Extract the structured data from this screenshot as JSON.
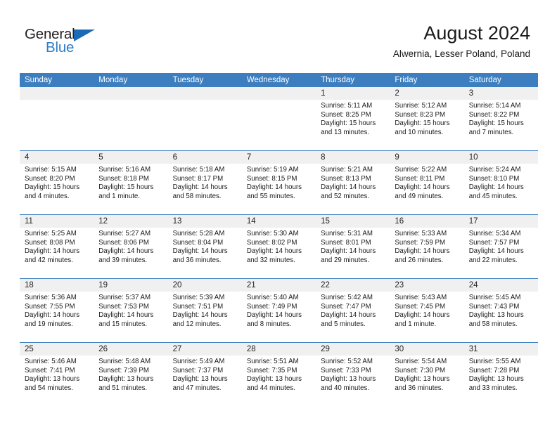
{
  "brand": {
    "name_part1": "General",
    "name_part2": "Blue",
    "logo_icon": "triangle-icon",
    "accent_blue": "#2a7dc9",
    "header_blue": "#3c7ebf"
  },
  "header": {
    "title": "August 2024",
    "subtitle": "Alwernia, Lesser Poland, Poland"
  },
  "calendar": {
    "weekday_headers": [
      "Sunday",
      "Monday",
      "Tuesday",
      "Wednesday",
      "Thursday",
      "Friday",
      "Saturday"
    ],
    "weeks": [
      [
        {
          "day": "",
          "empty": true,
          "sunrise": "",
          "sunset": "",
          "daylight1": "",
          "daylight2": ""
        },
        {
          "day": "",
          "empty": true,
          "sunrise": "",
          "sunset": "",
          "daylight1": "",
          "daylight2": ""
        },
        {
          "day": "",
          "empty": true,
          "sunrise": "",
          "sunset": "",
          "daylight1": "",
          "daylight2": ""
        },
        {
          "day": "",
          "empty": true,
          "sunrise": "",
          "sunset": "",
          "daylight1": "",
          "daylight2": ""
        },
        {
          "day": "1",
          "sunrise": "Sunrise: 5:11 AM",
          "sunset": "Sunset: 8:25 PM",
          "daylight1": "Daylight: 15 hours",
          "daylight2": "and 13 minutes."
        },
        {
          "day": "2",
          "sunrise": "Sunrise: 5:12 AM",
          "sunset": "Sunset: 8:23 PM",
          "daylight1": "Daylight: 15 hours",
          "daylight2": "and 10 minutes."
        },
        {
          "day": "3",
          "sunrise": "Sunrise: 5:14 AM",
          "sunset": "Sunset: 8:22 PM",
          "daylight1": "Daylight: 15 hours",
          "daylight2": "and 7 minutes."
        }
      ],
      [
        {
          "day": "4",
          "sunrise": "Sunrise: 5:15 AM",
          "sunset": "Sunset: 8:20 PM",
          "daylight1": "Daylight: 15 hours",
          "daylight2": "and 4 minutes."
        },
        {
          "day": "5",
          "sunrise": "Sunrise: 5:16 AM",
          "sunset": "Sunset: 8:18 PM",
          "daylight1": "Daylight: 15 hours",
          "daylight2": "and 1 minute."
        },
        {
          "day": "6",
          "sunrise": "Sunrise: 5:18 AM",
          "sunset": "Sunset: 8:17 PM",
          "daylight1": "Daylight: 14 hours",
          "daylight2": "and 58 minutes."
        },
        {
          "day": "7",
          "sunrise": "Sunrise: 5:19 AM",
          "sunset": "Sunset: 8:15 PM",
          "daylight1": "Daylight: 14 hours",
          "daylight2": "and 55 minutes."
        },
        {
          "day": "8",
          "sunrise": "Sunrise: 5:21 AM",
          "sunset": "Sunset: 8:13 PM",
          "daylight1": "Daylight: 14 hours",
          "daylight2": "and 52 minutes."
        },
        {
          "day": "9",
          "sunrise": "Sunrise: 5:22 AM",
          "sunset": "Sunset: 8:11 PM",
          "daylight1": "Daylight: 14 hours",
          "daylight2": "and 49 minutes."
        },
        {
          "day": "10",
          "sunrise": "Sunrise: 5:24 AM",
          "sunset": "Sunset: 8:10 PM",
          "daylight1": "Daylight: 14 hours",
          "daylight2": "and 45 minutes."
        }
      ],
      [
        {
          "day": "11",
          "sunrise": "Sunrise: 5:25 AM",
          "sunset": "Sunset: 8:08 PM",
          "daylight1": "Daylight: 14 hours",
          "daylight2": "and 42 minutes."
        },
        {
          "day": "12",
          "sunrise": "Sunrise: 5:27 AM",
          "sunset": "Sunset: 8:06 PM",
          "daylight1": "Daylight: 14 hours",
          "daylight2": "and 39 minutes."
        },
        {
          "day": "13",
          "sunrise": "Sunrise: 5:28 AM",
          "sunset": "Sunset: 8:04 PM",
          "daylight1": "Daylight: 14 hours",
          "daylight2": "and 36 minutes."
        },
        {
          "day": "14",
          "sunrise": "Sunrise: 5:30 AM",
          "sunset": "Sunset: 8:02 PM",
          "daylight1": "Daylight: 14 hours",
          "daylight2": "and 32 minutes."
        },
        {
          "day": "15",
          "sunrise": "Sunrise: 5:31 AM",
          "sunset": "Sunset: 8:01 PM",
          "daylight1": "Daylight: 14 hours",
          "daylight2": "and 29 minutes."
        },
        {
          "day": "16",
          "sunrise": "Sunrise: 5:33 AM",
          "sunset": "Sunset: 7:59 PM",
          "daylight1": "Daylight: 14 hours",
          "daylight2": "and 26 minutes."
        },
        {
          "day": "17",
          "sunrise": "Sunrise: 5:34 AM",
          "sunset": "Sunset: 7:57 PM",
          "daylight1": "Daylight: 14 hours",
          "daylight2": "and 22 minutes."
        }
      ],
      [
        {
          "day": "18",
          "sunrise": "Sunrise: 5:36 AM",
          "sunset": "Sunset: 7:55 PM",
          "daylight1": "Daylight: 14 hours",
          "daylight2": "and 19 minutes."
        },
        {
          "day": "19",
          "sunrise": "Sunrise: 5:37 AM",
          "sunset": "Sunset: 7:53 PM",
          "daylight1": "Daylight: 14 hours",
          "daylight2": "and 15 minutes."
        },
        {
          "day": "20",
          "sunrise": "Sunrise: 5:39 AM",
          "sunset": "Sunset: 7:51 PM",
          "daylight1": "Daylight: 14 hours",
          "daylight2": "and 12 minutes."
        },
        {
          "day": "21",
          "sunrise": "Sunrise: 5:40 AM",
          "sunset": "Sunset: 7:49 PM",
          "daylight1": "Daylight: 14 hours",
          "daylight2": "and 8 minutes."
        },
        {
          "day": "22",
          "sunrise": "Sunrise: 5:42 AM",
          "sunset": "Sunset: 7:47 PM",
          "daylight1": "Daylight: 14 hours",
          "daylight2": "and 5 minutes."
        },
        {
          "day": "23",
          "sunrise": "Sunrise: 5:43 AM",
          "sunset": "Sunset: 7:45 PM",
          "daylight1": "Daylight: 14 hours",
          "daylight2": "and 1 minute."
        },
        {
          "day": "24",
          "sunrise": "Sunrise: 5:45 AM",
          "sunset": "Sunset: 7:43 PM",
          "daylight1": "Daylight: 13 hours",
          "daylight2": "and 58 minutes."
        }
      ],
      [
        {
          "day": "25",
          "sunrise": "Sunrise: 5:46 AM",
          "sunset": "Sunset: 7:41 PM",
          "daylight1": "Daylight: 13 hours",
          "daylight2": "and 54 minutes."
        },
        {
          "day": "26",
          "sunrise": "Sunrise: 5:48 AM",
          "sunset": "Sunset: 7:39 PM",
          "daylight1": "Daylight: 13 hours",
          "daylight2": "and 51 minutes."
        },
        {
          "day": "27",
          "sunrise": "Sunrise: 5:49 AM",
          "sunset": "Sunset: 7:37 PM",
          "daylight1": "Daylight: 13 hours",
          "daylight2": "and 47 minutes."
        },
        {
          "day": "28",
          "sunrise": "Sunrise: 5:51 AM",
          "sunset": "Sunset: 7:35 PM",
          "daylight1": "Daylight: 13 hours",
          "daylight2": "and 44 minutes."
        },
        {
          "day": "29",
          "sunrise": "Sunrise: 5:52 AM",
          "sunset": "Sunset: 7:33 PM",
          "daylight1": "Daylight: 13 hours",
          "daylight2": "and 40 minutes."
        },
        {
          "day": "30",
          "sunrise": "Sunrise: 5:54 AM",
          "sunset": "Sunset: 7:30 PM",
          "daylight1": "Daylight: 13 hours",
          "daylight2": "and 36 minutes."
        },
        {
          "day": "31",
          "sunrise": "Sunrise: 5:55 AM",
          "sunset": "Sunset: 7:28 PM",
          "daylight1": "Daylight: 13 hours",
          "daylight2": "and 33 minutes."
        }
      ]
    ]
  }
}
